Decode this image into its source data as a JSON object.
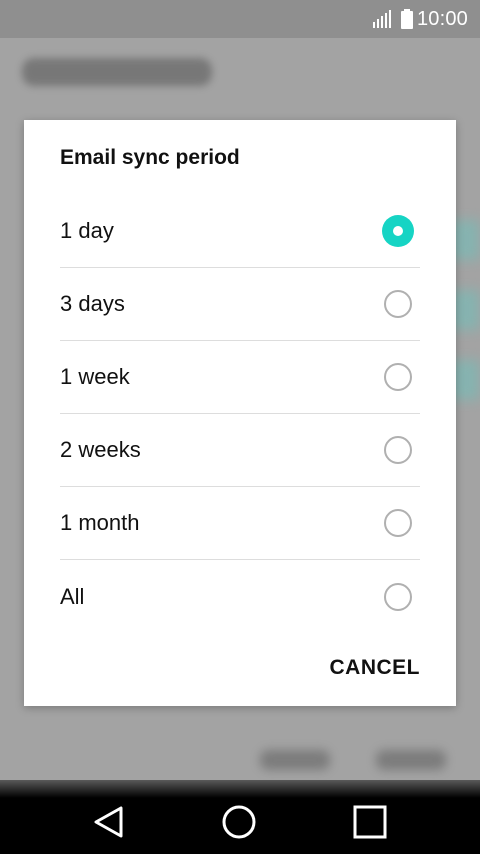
{
  "status_bar": {
    "time": "10:00",
    "signal_icon": "signal-icon",
    "battery_icon": "battery-icon"
  },
  "dialog": {
    "title": "Email sync period",
    "options": [
      {
        "label": "1 day",
        "selected": true
      },
      {
        "label": "3 days",
        "selected": false
      },
      {
        "label": "1 week",
        "selected": false
      },
      {
        "label": "2 weeks",
        "selected": false
      },
      {
        "label": "1 month",
        "selected": false
      },
      {
        "label": "All",
        "selected": false
      }
    ],
    "cancel_label": "CANCEL"
  },
  "nav_bar": {
    "back_icon": "back-triangle-icon",
    "home_icon": "home-circle-icon",
    "recents_icon": "recents-square-icon"
  },
  "colors": {
    "accent": "#16d4c4",
    "scrim": "#9e9e9e",
    "dialog_bg": "#ffffff"
  }
}
